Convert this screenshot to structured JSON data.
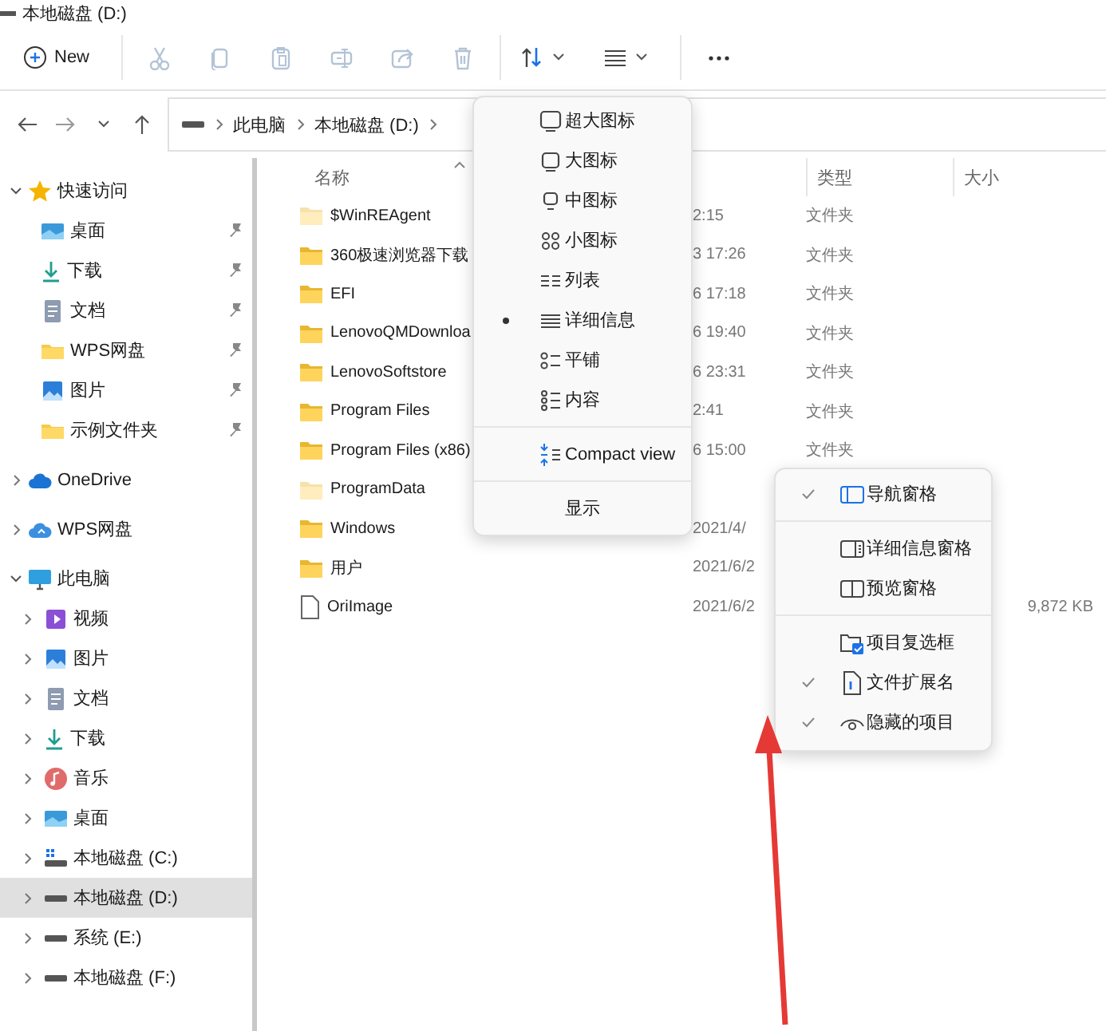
{
  "window": {
    "title": "本地磁盘 (D:)"
  },
  "toolbar": [
    {
      "kind": "new",
      "label": "New",
      "disabled": false
    },
    {
      "kind": "cut",
      "disabled": true
    },
    {
      "kind": "copy",
      "disabled": true
    },
    {
      "kind": "paste",
      "disabled": true
    },
    {
      "kind": "rename",
      "disabled": true
    },
    {
      "kind": "share",
      "disabled": true
    },
    {
      "kind": "delete",
      "disabled": true
    },
    {
      "kind": "sort"
    },
    {
      "kind": "view"
    },
    {
      "kind": "more"
    }
  ],
  "address": {
    "crumbs": [
      "此电脑",
      "本地磁盘 (D:)"
    ]
  },
  "sidebar": {
    "items": [
      {
        "label": "快速访问",
        "kind": "star",
        "expanded": true,
        "selected": false,
        "children": [
          {
            "label": "桌面",
            "kind": "desktop",
            "pinned": true,
            "selected": false
          },
          {
            "label": "下载",
            "kind": "download",
            "pinned": true,
            "selected": false
          },
          {
            "label": "文档",
            "kind": "documents",
            "pinned": true,
            "selected": false
          },
          {
            "label": "WPS网盘",
            "kind": "folder",
            "pinned": true,
            "selected": false
          },
          {
            "label": "图片",
            "kind": "pictures",
            "pinned": true,
            "selected": false
          },
          {
            "label": "示例文件夹",
            "kind": "folder",
            "pinned": true,
            "selected": false
          }
        ]
      },
      {
        "label": "OneDrive",
        "kind": "cloud",
        "expanded": false,
        "selected": false
      },
      {
        "label": "WPS网盘",
        "kind": "cloud2",
        "expanded": false,
        "selected": false
      },
      {
        "label": "此电脑",
        "kind": "pc",
        "expanded": true,
        "selected": false,
        "children": [
          {
            "label": "视频",
            "kind": "videos",
            "expanded": false,
            "selected": false
          },
          {
            "label": "图片",
            "kind": "pictures",
            "expanded": false,
            "selected": false
          },
          {
            "label": "文档",
            "kind": "documents",
            "expanded": false,
            "selected": false
          },
          {
            "label": "下载",
            "kind": "download",
            "expanded": false,
            "selected": false
          },
          {
            "label": "音乐",
            "kind": "music",
            "expanded": false,
            "selected": false
          },
          {
            "label": "桌面",
            "kind": "desktop",
            "expanded": false,
            "selected": false
          },
          {
            "label": "本地磁盘 (C:)",
            "kind": "system-drive",
            "expanded": false,
            "selected": false
          },
          {
            "label": "本地磁盘 (D:)",
            "kind": "drive",
            "expanded": false,
            "selected": true
          },
          {
            "label": "系统 (E:)",
            "kind": "drive",
            "expanded": false,
            "selected": false
          },
          {
            "label": "本地磁盘 (F:)",
            "kind": "drive",
            "expanded": false,
            "selected": false
          }
        ]
      }
    ]
  },
  "file_list": {
    "columns": [
      {
        "label": "名称",
        "sorted": true
      },
      {
        "label": "类型",
        "sorted": false
      },
      {
        "label": "大小",
        "sorted": false
      }
    ],
    "rows": [
      {
        "name": "$WinREAgent",
        "kind": "folder",
        "hidden": true,
        "modified": "2:15",
        "type": "文件夹"
      },
      {
        "name": "360极速浏览器下载",
        "kind": "folder",
        "hidden": false,
        "modified": "3 17:26",
        "type": "文件夹"
      },
      {
        "name": "EFI",
        "kind": "folder",
        "hidden": false,
        "modified": "6 17:18",
        "type": "文件夹"
      },
      {
        "name": "LenovoQMDownloa",
        "kind": "folder",
        "hidden": false,
        "modified": "6 19:40",
        "type": "文件夹"
      },
      {
        "name": "LenovoSoftstore",
        "kind": "folder",
        "hidden": false,
        "modified": "6 23:31",
        "type": "文件夹"
      },
      {
        "name": "Program Files",
        "kind": "folder",
        "hidden": false,
        "modified": "2:41",
        "type": "文件夹"
      },
      {
        "name": "Program Files (x86)",
        "kind": "folder",
        "hidden": false,
        "modified": "6 15:00",
        "type": "文件夹"
      },
      {
        "name": "ProgramData",
        "kind": "folder",
        "hidden": true
      },
      {
        "name": "Windows",
        "kind": "folder",
        "hidden": false,
        "modified": "2021/4/"
      },
      {
        "name": "用户",
        "kind": "folder",
        "hidden": false,
        "modified": "2021/6/2"
      },
      {
        "name": "OriImage",
        "kind": "file",
        "hidden": false,
        "modified": "2021/6/2",
        "size": "9,872 KB"
      }
    ]
  },
  "view_menu": {
    "layouts": [
      {
        "kind": "extra-large",
        "label": "超大图标",
        "selected": false
      },
      {
        "kind": "large",
        "label": "大图标",
        "selected": false
      },
      {
        "kind": "medium",
        "label": "中图标",
        "selected": false
      },
      {
        "kind": "small",
        "label": "小图标",
        "selected": false
      },
      {
        "kind": "list",
        "label": "列表",
        "selected": false
      },
      {
        "kind": "details",
        "label": "详细信息",
        "selected": true
      },
      {
        "kind": "tiles",
        "label": "平铺",
        "selected": false
      },
      {
        "kind": "content",
        "label": "内容",
        "selected": false
      }
    ],
    "compact_view": {
      "label": "Compact view",
      "checked": false
    },
    "show": {
      "label": "显示"
    }
  },
  "show_menu": {
    "items": [
      {
        "kind": "navigation-pane",
        "label": "导航窗格",
        "checked": true,
        "separator_before": false
      },
      {
        "kind": "details-pane",
        "label": "详细信息窗格",
        "checked": false,
        "separator_before": true
      },
      {
        "kind": "preview-pane",
        "label": "预览窗格",
        "checked": false,
        "separator_before": false
      },
      {
        "kind": "item-checkboxes",
        "label": "项目复选框",
        "checked": false,
        "separator_before": true
      },
      {
        "kind": "file-extensions",
        "label": "文件扩展名",
        "checked": true,
        "separator_before": false
      },
      {
        "kind": "hidden-items",
        "label": "隐藏的项目",
        "checked": true,
        "separator_before": false
      }
    ]
  }
}
